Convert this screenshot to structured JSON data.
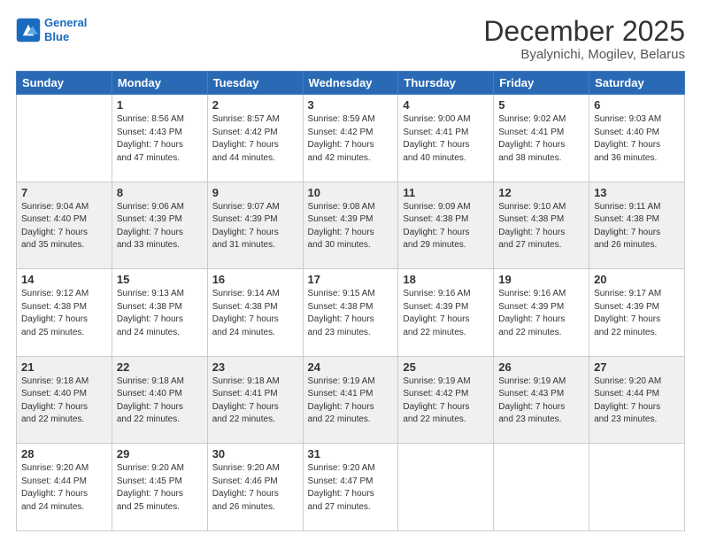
{
  "header": {
    "logo_line1": "General",
    "logo_line2": "Blue",
    "title": "December 2025",
    "subtitle": "Byalynichi, Mogilev, Belarus"
  },
  "days_of_week": [
    "Sunday",
    "Monday",
    "Tuesday",
    "Wednesday",
    "Thursday",
    "Friday",
    "Saturday"
  ],
  "weeks": [
    [
      {
        "day": "",
        "info": ""
      },
      {
        "day": "1",
        "info": "Sunrise: 8:56 AM\nSunset: 4:43 PM\nDaylight: 7 hours\nand 47 minutes."
      },
      {
        "day": "2",
        "info": "Sunrise: 8:57 AM\nSunset: 4:42 PM\nDaylight: 7 hours\nand 44 minutes."
      },
      {
        "day": "3",
        "info": "Sunrise: 8:59 AM\nSunset: 4:42 PM\nDaylight: 7 hours\nand 42 minutes."
      },
      {
        "day": "4",
        "info": "Sunrise: 9:00 AM\nSunset: 4:41 PM\nDaylight: 7 hours\nand 40 minutes."
      },
      {
        "day": "5",
        "info": "Sunrise: 9:02 AM\nSunset: 4:41 PM\nDaylight: 7 hours\nand 38 minutes."
      },
      {
        "day": "6",
        "info": "Sunrise: 9:03 AM\nSunset: 4:40 PM\nDaylight: 7 hours\nand 36 minutes."
      }
    ],
    [
      {
        "day": "7",
        "info": "Sunrise: 9:04 AM\nSunset: 4:40 PM\nDaylight: 7 hours\nand 35 minutes."
      },
      {
        "day": "8",
        "info": "Sunrise: 9:06 AM\nSunset: 4:39 PM\nDaylight: 7 hours\nand 33 minutes."
      },
      {
        "day": "9",
        "info": "Sunrise: 9:07 AM\nSunset: 4:39 PM\nDaylight: 7 hours\nand 31 minutes."
      },
      {
        "day": "10",
        "info": "Sunrise: 9:08 AM\nSunset: 4:39 PM\nDaylight: 7 hours\nand 30 minutes."
      },
      {
        "day": "11",
        "info": "Sunrise: 9:09 AM\nSunset: 4:38 PM\nDaylight: 7 hours\nand 29 minutes."
      },
      {
        "day": "12",
        "info": "Sunrise: 9:10 AM\nSunset: 4:38 PM\nDaylight: 7 hours\nand 27 minutes."
      },
      {
        "day": "13",
        "info": "Sunrise: 9:11 AM\nSunset: 4:38 PM\nDaylight: 7 hours\nand 26 minutes."
      }
    ],
    [
      {
        "day": "14",
        "info": "Sunrise: 9:12 AM\nSunset: 4:38 PM\nDaylight: 7 hours\nand 25 minutes."
      },
      {
        "day": "15",
        "info": "Sunrise: 9:13 AM\nSunset: 4:38 PM\nDaylight: 7 hours\nand 24 minutes."
      },
      {
        "day": "16",
        "info": "Sunrise: 9:14 AM\nSunset: 4:38 PM\nDaylight: 7 hours\nand 24 minutes."
      },
      {
        "day": "17",
        "info": "Sunrise: 9:15 AM\nSunset: 4:38 PM\nDaylight: 7 hours\nand 23 minutes."
      },
      {
        "day": "18",
        "info": "Sunrise: 9:16 AM\nSunset: 4:39 PM\nDaylight: 7 hours\nand 22 minutes."
      },
      {
        "day": "19",
        "info": "Sunrise: 9:16 AM\nSunset: 4:39 PM\nDaylight: 7 hours\nand 22 minutes."
      },
      {
        "day": "20",
        "info": "Sunrise: 9:17 AM\nSunset: 4:39 PM\nDaylight: 7 hours\nand 22 minutes."
      }
    ],
    [
      {
        "day": "21",
        "info": "Sunrise: 9:18 AM\nSunset: 4:40 PM\nDaylight: 7 hours\nand 22 minutes."
      },
      {
        "day": "22",
        "info": "Sunrise: 9:18 AM\nSunset: 4:40 PM\nDaylight: 7 hours\nand 22 minutes."
      },
      {
        "day": "23",
        "info": "Sunrise: 9:18 AM\nSunset: 4:41 PM\nDaylight: 7 hours\nand 22 minutes."
      },
      {
        "day": "24",
        "info": "Sunrise: 9:19 AM\nSunset: 4:41 PM\nDaylight: 7 hours\nand 22 minutes."
      },
      {
        "day": "25",
        "info": "Sunrise: 9:19 AM\nSunset: 4:42 PM\nDaylight: 7 hours\nand 22 minutes."
      },
      {
        "day": "26",
        "info": "Sunrise: 9:19 AM\nSunset: 4:43 PM\nDaylight: 7 hours\nand 23 minutes."
      },
      {
        "day": "27",
        "info": "Sunrise: 9:20 AM\nSunset: 4:44 PM\nDaylight: 7 hours\nand 23 minutes."
      }
    ],
    [
      {
        "day": "28",
        "info": "Sunrise: 9:20 AM\nSunset: 4:44 PM\nDaylight: 7 hours\nand 24 minutes."
      },
      {
        "day": "29",
        "info": "Sunrise: 9:20 AM\nSunset: 4:45 PM\nDaylight: 7 hours\nand 25 minutes."
      },
      {
        "day": "30",
        "info": "Sunrise: 9:20 AM\nSunset: 4:46 PM\nDaylight: 7 hours\nand 26 minutes."
      },
      {
        "day": "31",
        "info": "Sunrise: 9:20 AM\nSunset: 4:47 PM\nDaylight: 7 hours\nand 27 minutes."
      },
      {
        "day": "",
        "info": ""
      },
      {
        "day": "",
        "info": ""
      },
      {
        "day": "",
        "info": ""
      }
    ]
  ]
}
